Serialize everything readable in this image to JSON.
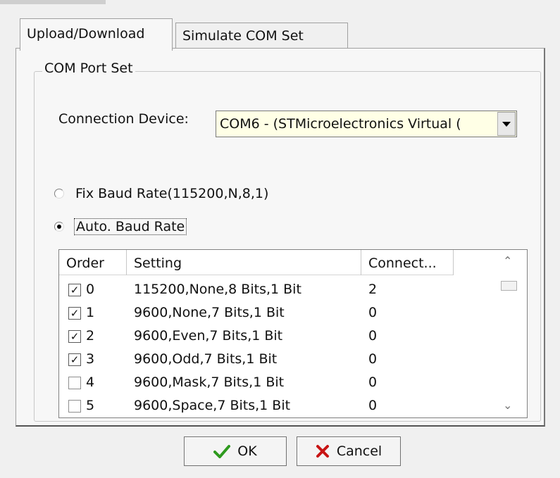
{
  "tabs": [
    {
      "label": "Upload/Download",
      "active": true
    },
    {
      "label": "Simulate COM Set",
      "active": false
    }
  ],
  "group": {
    "title": "COM Port Set",
    "connection_label": "Connection Device:",
    "connection_value": "COM6 - (STMicroelectronics Virtual (",
    "radio_fix_label": "Fix Baud Rate(115200,N,8,1)",
    "radio_fix_checked": false,
    "radio_auto_label": "Auto. Baud Rate",
    "radio_auto_checked": true
  },
  "list": {
    "headers": [
      "Order",
      "Setting",
      "Connect..."
    ],
    "rows": [
      {
        "checked": true,
        "order": "0",
        "setting": "115200,None,8 Bits,1 Bit",
        "connect": "2"
      },
      {
        "checked": true,
        "order": "1",
        "setting": "9600,None,7 Bits,1 Bit",
        "connect": "0"
      },
      {
        "checked": true,
        "order": "2",
        "setting": "9600,Even,7 Bits,1 Bit",
        "connect": "0"
      },
      {
        "checked": true,
        "order": "3",
        "setting": "9600,Odd,7 Bits,1 Bit",
        "connect": "0"
      },
      {
        "checked": false,
        "order": "4",
        "setting": "9600,Mask,7 Bits,1 Bit",
        "connect": "0"
      },
      {
        "checked": false,
        "order": "5",
        "setting": "9600,Space,7 Bits,1 Bit",
        "connect": "0"
      }
    ]
  },
  "buttons": {
    "ok_label": "OK",
    "cancel_label": "Cancel"
  },
  "icons": {
    "ok": "checkmark-icon",
    "cancel": "x-icon",
    "combo": "chevron-down-icon",
    "scroll_up": "chevron-up-icon",
    "scroll_down": "chevron-down-icon"
  },
  "colors": {
    "ok_icon": "#2e9a1e",
    "cancel_icon": "#c81414",
    "combo_bg": "#ffffe6"
  }
}
